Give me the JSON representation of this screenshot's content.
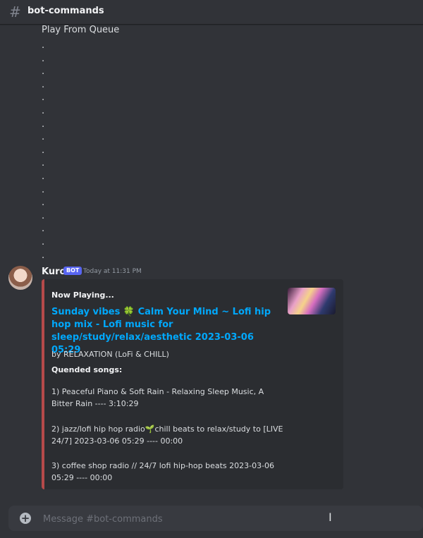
{
  "header": {
    "channel_name": "bot-commands",
    "hash_icon": "#"
  },
  "messages": {
    "queue_title": "Play From Queue",
    "dots": ".\n.\n.\n.\n.\n.\n.\n.\n.\n.\n.\n.\n.\n.\n.\n.\n.\n."
  },
  "message": {
    "author": "Kuro",
    "bot_badge": "BOT",
    "timestamp": "Today at 11:31 PM",
    "embed": {
      "author": "Now Playing...",
      "title": "Sunday vibes 🍀 Calm Your Mind ~ Lofi hip hop mix - Lofi music for sleep/study/relax/aesthetic 2023-03-06 05:29",
      "description": "by RELAXATION (LoFi & CHILL)",
      "queue_label": "Quended songs:",
      "queue": [
        "1) Peaceful Piano & Soft Rain - Relaxing Sleep Music, A Bitter Rain ---- 3:10:29",
        "2) jazz/lofi hip hop radio🌱chill beats to relax/study to [LIVE 24/7] 2023-03-06 05:29 ---- 00:00",
        "3) coffee shop radio // 24/7 lofi hip-hop beats 2023-03-06 05:29 ---- 00:00"
      ],
      "accent_color": "#b54a4a"
    }
  },
  "composer": {
    "placeholder": "Message #bot-commands",
    "plus_icon": "+",
    "cursor_icon": "I"
  }
}
